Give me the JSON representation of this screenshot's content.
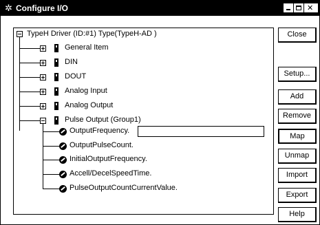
{
  "window": {
    "title": "Configure I/O",
    "title_icon": "sparkle-icon"
  },
  "tree": {
    "root": {
      "label": "TypeH Driver (ID:#1) Type(TypeH-AD )"
    },
    "groups": [
      {
        "label": "General Item",
        "expanded": false
      },
      {
        "label": "DIN",
        "expanded": false
      },
      {
        "label": "DOUT",
        "expanded": false
      },
      {
        "label": "Analog Input",
        "expanded": false
      },
      {
        "label": "Analog Output",
        "expanded": false
      },
      {
        "label": "Pulse Output (Group1)",
        "expanded": true
      }
    ],
    "items": [
      {
        "label": "OutputFrequency."
      },
      {
        "label": "OutputPulseCount."
      },
      {
        "label": "InitialOutputFrequency."
      },
      {
        "label": "Accell/DecelSpeedTime."
      },
      {
        "label": "PulseOutputCountCurrentValue."
      }
    ],
    "edit_value": ""
  },
  "buttons": {
    "close": "Close",
    "setup": "Setup...",
    "add": "Add",
    "remove": "Remove",
    "map": "Map",
    "unmap": "Unmap",
    "import": "Import",
    "export": "Export",
    "help": "Help"
  }
}
